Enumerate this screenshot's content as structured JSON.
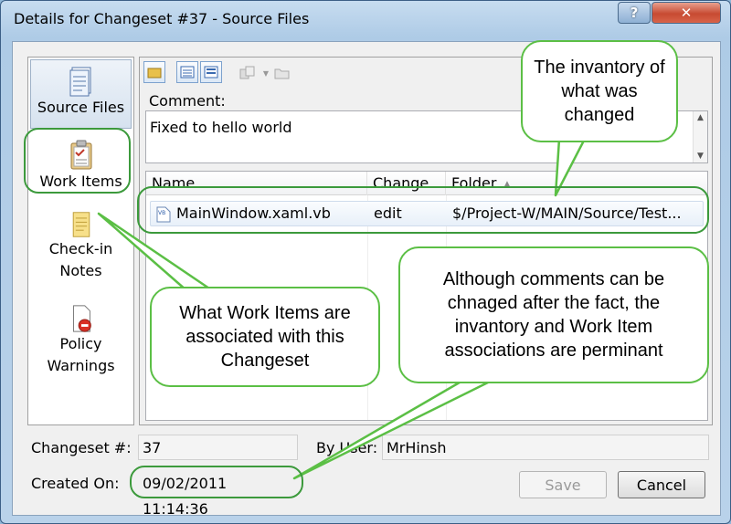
{
  "window": {
    "title": "Details for Changeset #37 - Source Files",
    "help_glyph": "?",
    "close_glyph": "✕"
  },
  "nav": {
    "items": [
      {
        "label": "Source Files",
        "selected": true
      },
      {
        "label": "Work Items",
        "selected": false
      },
      {
        "label": "Check-in\nNotes",
        "selected": false
      },
      {
        "label": "Policy\nWarnings",
        "selected": false
      }
    ]
  },
  "comment": {
    "label": "Comment:",
    "text": "Fixed to hello world"
  },
  "file_list": {
    "columns": [
      "Name",
      "Change",
      "Folder"
    ],
    "rows": [
      {
        "name": "MainWindow.xaml.vb",
        "change": "edit",
        "folder": "$/Project-W/MAIN/Source/Test..."
      }
    ]
  },
  "form": {
    "changeset_label": "Changeset #:",
    "changeset_value": "37",
    "user_label": "By User:",
    "user_value": "MrHinsh",
    "created_label": "Created On:",
    "created_value": "09/02/2011 11:14:36"
  },
  "buttons": {
    "save": "Save",
    "cancel": "Cancel"
  },
  "callouts": {
    "inventory": "The invantory of what was changed",
    "work_items": "What Work Items are associated with this Changeset",
    "permanent": "Although comments can be chnaged after the fact, the invantory and Work Item associations are perminant"
  },
  "colors": {
    "annotation_green": "#5bbf45",
    "close_red": "#c74a32",
    "selection_blue": "#d6e2ef"
  },
  "icons": [
    "question-icon",
    "close-icon",
    "source-files-icon",
    "work-items-icon",
    "check-in-notes-icon",
    "policy-warnings-icon",
    "vb-file-icon",
    "folder-icon"
  ]
}
